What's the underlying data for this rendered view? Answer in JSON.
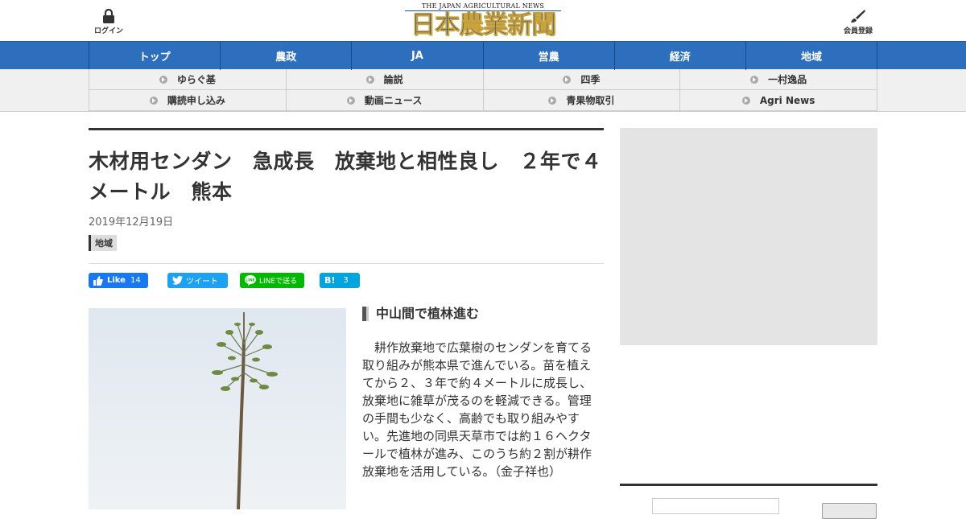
{
  "header": {
    "login_label": "ログイン",
    "logo_en": "THE JAPAN AGRICULTURAL NEWS",
    "logo_jp": "日本農業新聞",
    "member_label": "会員登録"
  },
  "main_nav": [
    "トップ",
    "農政",
    "JA",
    "営農",
    "経済",
    "地域"
  ],
  "sub_nav": [
    "ゆらぐ基",
    "論説",
    "四季",
    "一村逸品",
    "購読申し込み",
    "動画ニュース",
    "青果物取引",
    "Agri News"
  ],
  "article": {
    "title": "木材用センダン　急成長　放棄地と相性良し　２年で４メートル　熊本",
    "date": "2019年12月19日",
    "category": "地域",
    "subhead": "中山間で植林進む",
    "body": "耕作放棄地で広葉樹のセンダンを育てる取り組みが熊本県で進んでいる。苗を植えてから２、３年で約４メートルに成長し、放棄地に雑草が茂るのを軽減できる。管理の手間も少なく、高齢でも取り組みやすい。先進地の同県天草市では約１６ヘクタールで植林が進み、このうち約２割が耕作放棄地を活用している。（金子祥也）"
  },
  "share": {
    "fb_label": "Like",
    "fb_count": "14",
    "tw_label": "ツイート",
    "line_label": "LINEで送る",
    "hb_label": "B!",
    "hb_count": "3"
  },
  "colors": {
    "nav_blue": "#2e6fbd",
    "logo_blue": "#1e4f9d",
    "logo_gold": "#c9a23a",
    "facebook": "#1877f2",
    "twitter": "#1da1f2",
    "line": "#00b900",
    "hatena": "#00a4de"
  }
}
